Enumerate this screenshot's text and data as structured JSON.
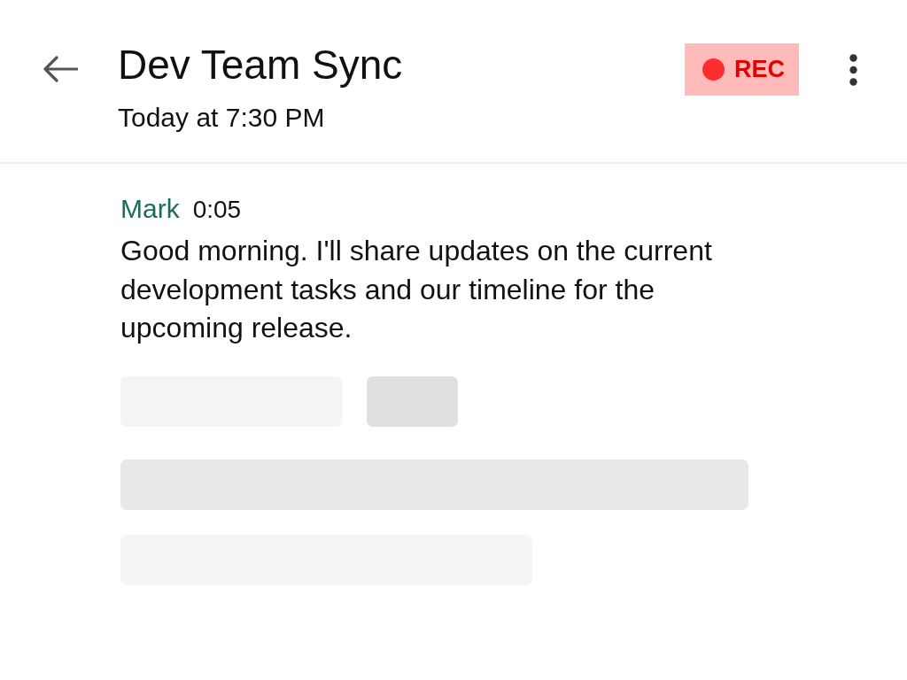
{
  "header": {
    "title": "Dev Team Sync",
    "subtitle": "Today at 7:30 PM",
    "rec_badge": {
      "label": "REC"
    }
  },
  "transcript": {
    "entries": [
      {
        "speaker": "Mark",
        "time": "0:05",
        "text": "Good morning. I'll share updates on the current development tasks and our timeline for the upcoming release."
      }
    ],
    "loading": true
  }
}
